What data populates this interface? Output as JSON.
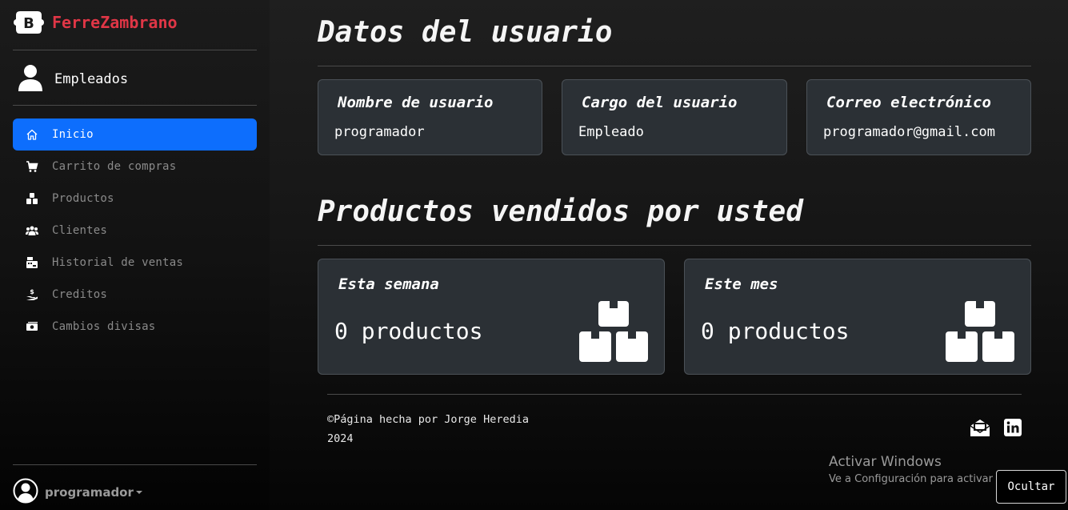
{
  "brand": {
    "name": "FerreZambrano",
    "logo_letter": "B"
  },
  "user_section": {
    "label": "Empleados"
  },
  "nav": [
    {
      "label": "Inicio",
      "icon": "house-icon",
      "active": true
    },
    {
      "label": "Carrito de compras",
      "icon": "cart-icon",
      "active": false
    },
    {
      "label": "Productos",
      "icon": "boxes-icon",
      "active": false
    },
    {
      "label": "Clientes",
      "icon": "users-icon",
      "active": false
    },
    {
      "label": "Historial de ventas",
      "icon": "cash-register-icon",
      "active": false
    },
    {
      "label": "Creditos",
      "icon": "hand-coin-icon",
      "active": false
    },
    {
      "label": "Cambios divisas",
      "icon": "money-bill-icon",
      "active": false
    }
  ],
  "profile": {
    "name": "programador"
  },
  "user_data": {
    "title": "Datos del usuario",
    "cards": [
      {
        "heading": "Nombre de usuario",
        "value": "programador"
      },
      {
        "heading": "Cargo del usuario",
        "value": "Empleado"
      },
      {
        "heading": "Correo electrónico",
        "value": "programador@gmail.com"
      }
    ]
  },
  "sales": {
    "title": "Productos vendidos por usted",
    "cards": [
      {
        "heading": "Esta semana",
        "value": "0 productos"
      },
      {
        "heading": "Este mes",
        "value": "0 productos"
      }
    ]
  },
  "footer": {
    "text_line1": "©Página hecha por Jorge Heredia",
    "text_line2": "2024",
    "icons": [
      "envelope-open-icon",
      "linkedin-icon"
    ]
  },
  "windows_watermark": {
    "title": "Activar Windows",
    "subtitle": "Ve a Configuración para activar Windows."
  },
  "hide_button": {
    "label": "Ocultar"
  },
  "colors": {
    "accent": "#0d6efd",
    "brand": "#e03646",
    "card_bg": "#2b3035"
  }
}
